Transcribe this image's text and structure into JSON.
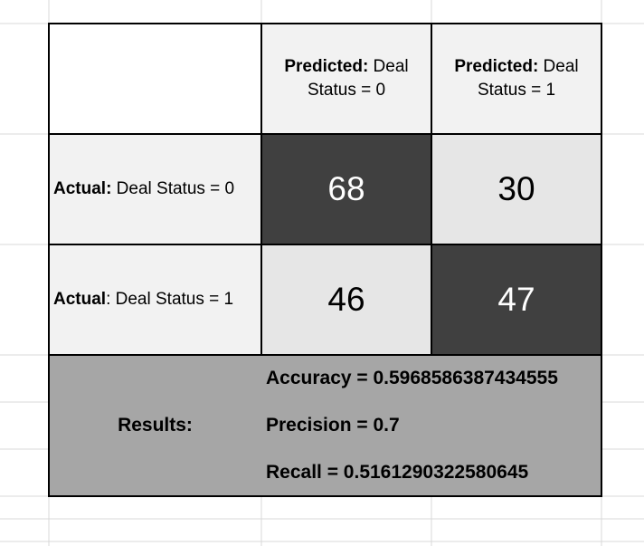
{
  "matrix": {
    "header_col1": {
      "bold": "Predicted:",
      "rest_line1": " Deal",
      "line2": "Status = 0"
    },
    "header_col2": {
      "bold": "Predicted:",
      "rest_line1": " Deal",
      "line2": "Status = 1"
    },
    "row1_label": {
      "bold": "Actual:",
      "rest": " Deal Status = 0"
    },
    "row2_label": {
      "bold": "Actual",
      "rest": ": Deal Status = 1"
    },
    "values": {
      "r1c1": "68",
      "r1c2": "30",
      "r2c1": "46",
      "r2c2": "47"
    }
  },
  "results": {
    "label": "Results:",
    "accuracy": "Accuracy = 0.5968586387434555",
    "precision": "Precision = 0.7",
    "recall": "Recall = 0.5161290322580645"
  },
  "colors": {
    "header_bg": "#f2f2f2",
    "dark_cell": "#404040",
    "light_cell": "#e6e6e6",
    "results_bg": "#a6a6a6",
    "gridline": "#d9d9d9"
  }
}
